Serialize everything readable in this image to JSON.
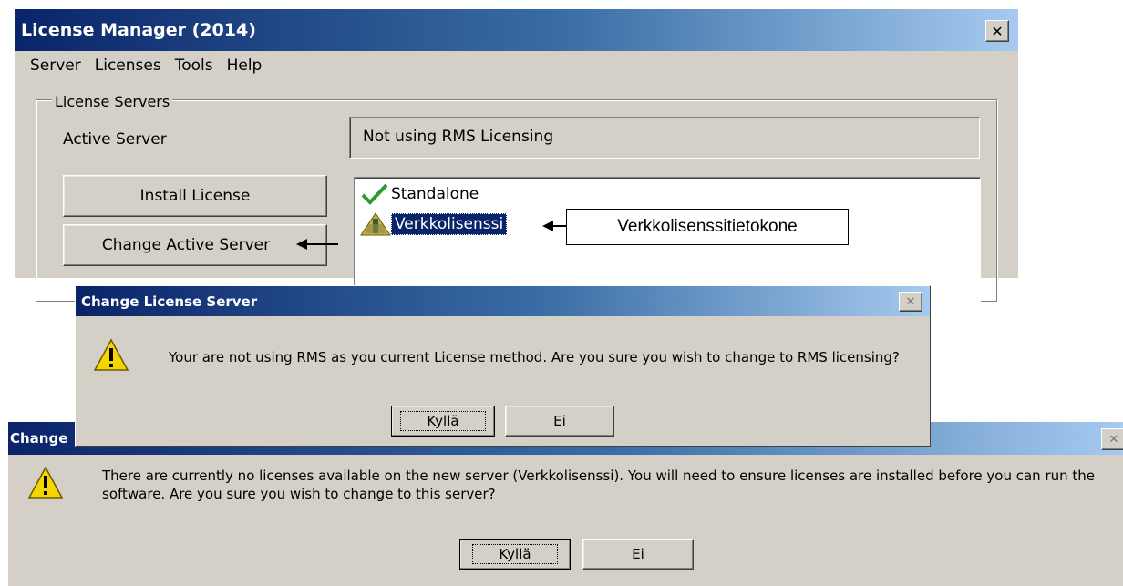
{
  "license_manager": {
    "title": "License Manager (2014)",
    "close_glyph": "✕",
    "menu": [
      "Server",
      "Licenses",
      "Tools",
      "Help"
    ],
    "group_label": "License Servers",
    "active_server_label": "Active Server",
    "active_server_value": "Not using RMS Licensing",
    "install_license_button": "Install License",
    "change_server_button": "Change Active Server",
    "servers": [
      {
        "name": "Standalone",
        "icon": "check-icon",
        "selected": false
      },
      {
        "name": "Verkkolisenssi",
        "icon": "network-warning-icon",
        "selected": true
      }
    ]
  },
  "annotation": {
    "callout_text": "Verkkolisenssitietokone"
  },
  "dialog1": {
    "title": "Change License Server",
    "message": "Your are not using RMS as you current License method. Are you sure you wish to change to RMS licensing?",
    "yes_button": "Kyllä",
    "no_button": "Ei"
  },
  "dialog2": {
    "title": "Change",
    "message_line1": "There are currently no licenses available on the new server (Verkkolisenssi). You will need to ensure licenses are installed before you can run the",
    "message_line2": "software. Are you sure you wish to change to this server?",
    "yes_button": "Kyllä",
    "no_button": "Ei"
  },
  "colors": {
    "title_gradient_start": "#0a246a",
    "title_gradient_end": "#a6caf0",
    "dialog_face": "#d4d0c8",
    "selection": "#0a246a",
    "check_green": "#2c9a2c",
    "warning_yellow": "#f5d500"
  }
}
